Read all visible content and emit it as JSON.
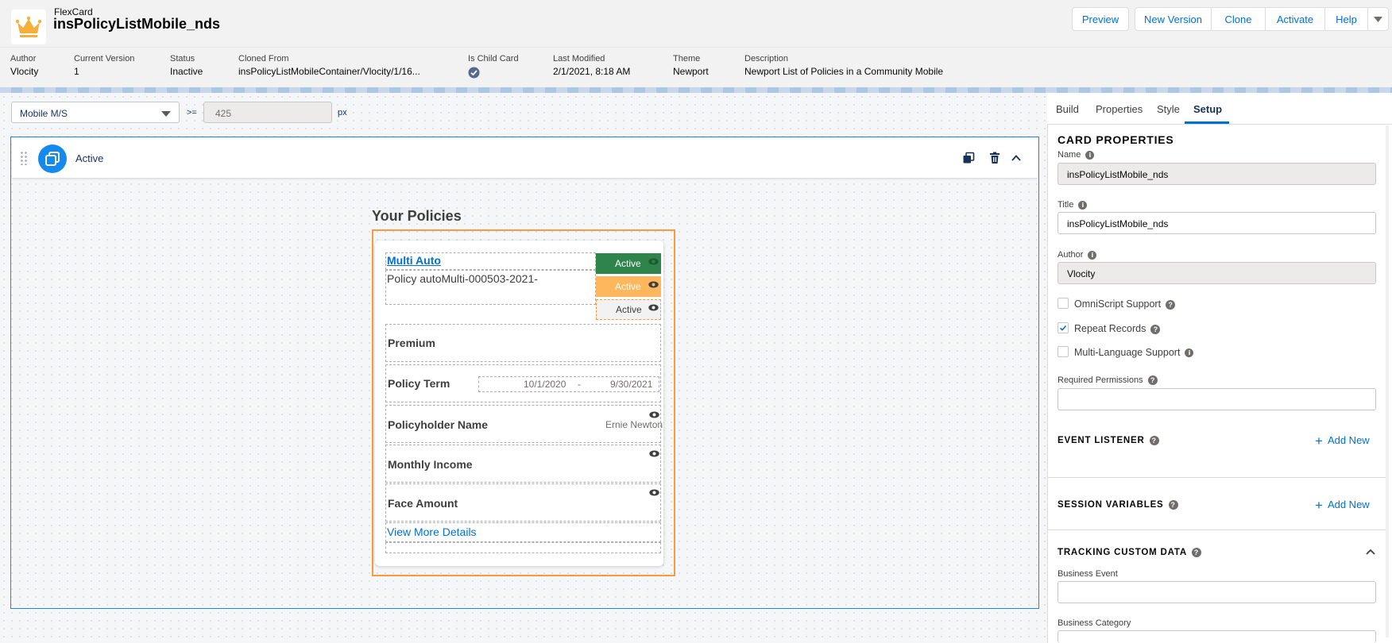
{
  "header": {
    "kind": "FlexCard",
    "title": "insPolicyListMobile_nds",
    "buttons": {
      "preview": "Preview",
      "new_version": "New Version",
      "clone": "Clone",
      "activate": "Activate",
      "help": "Help"
    }
  },
  "meta": {
    "author": {
      "label": "Author",
      "value": "Vlocity"
    },
    "current_version": {
      "label": "Current Version",
      "value": "1"
    },
    "status": {
      "label": "Status",
      "value": "Inactive"
    },
    "cloned_from": {
      "label": "Cloned From",
      "value": "insPolicyListMobileContainer/Vlocity/1/16..."
    },
    "is_child_card": {
      "label": "Is Child Card",
      "value": true
    },
    "last_modified": {
      "label": "Last Modified",
      "value": "2/1/2021, 8:18 AM"
    },
    "theme": {
      "label": "Theme",
      "value": "Newport"
    },
    "description": {
      "label": "Description",
      "value": "Newport List of Policies in a Community Mobile"
    }
  },
  "canvas": {
    "viewport_select": "Mobile M/S",
    "operator": ">=",
    "width_value": "425",
    "unit": "px",
    "state_name": "Active",
    "card": {
      "heading": "Your Policies",
      "policy_type": "Multi Auto",
      "policy_number": "Policy autoMulti-000503-2021-",
      "badges": [
        "Active",
        "Active",
        "Active"
      ],
      "fields": {
        "premium": "Premium",
        "policy_term": "Policy Term",
        "term_start": "10/1/2020",
        "term_sep": "-",
        "term_end": "9/30/2021",
        "policyholder_name": "Policyholder Name",
        "policyholder_value": "Ernie Newton",
        "monthly_income": "Monthly Income",
        "face_amount": "Face Amount"
      },
      "view_more": "View More Details"
    }
  },
  "panel": {
    "tabs": [
      "Build",
      "Properties",
      "Style",
      "Setup"
    ],
    "active_tab": "Setup",
    "card_properties": {
      "title": "CARD PROPERTIES",
      "name_label": "Name",
      "name_value": "insPolicyListMobile_nds",
      "title_label": "Title",
      "title_value": "insPolicyListMobile_nds",
      "author_label": "Author",
      "author_value": "Vlocity",
      "omniscript_support": {
        "label": "OmniScript Support",
        "checked": false
      },
      "repeat_records": {
        "label": "Repeat Records",
        "checked": true
      },
      "multi_language": {
        "label": "Multi-Language Support",
        "checked": false
      },
      "required_permissions_label": "Required Permissions",
      "required_permissions_value": ""
    },
    "event_listener": {
      "title": "EVENT LISTENER",
      "add": "Add New"
    },
    "session_variables": {
      "title": "SESSION VARIABLES",
      "add": "Add New"
    },
    "tracking": {
      "title": "TRACKING CUSTOM DATA",
      "business_event_label": "Business Event",
      "business_event_value": "",
      "business_category_label": "Business Category"
    }
  },
  "colors": {
    "brand_blue": "#0070d2",
    "active_green": "#2e844a",
    "active_orange": "#ffb75d",
    "selection_orange": "#ff9a3c",
    "logo_gold": "#f4b03a"
  },
  "icons": [
    "crown-icon",
    "checkmark-circle-icon",
    "drag-handle-icon",
    "card-state-icon",
    "duplicate-icon",
    "delete-icon",
    "chevron-up-icon",
    "eye-icon",
    "info-icon",
    "help-icon",
    "add-icon",
    "chevron-down-icon"
  ]
}
